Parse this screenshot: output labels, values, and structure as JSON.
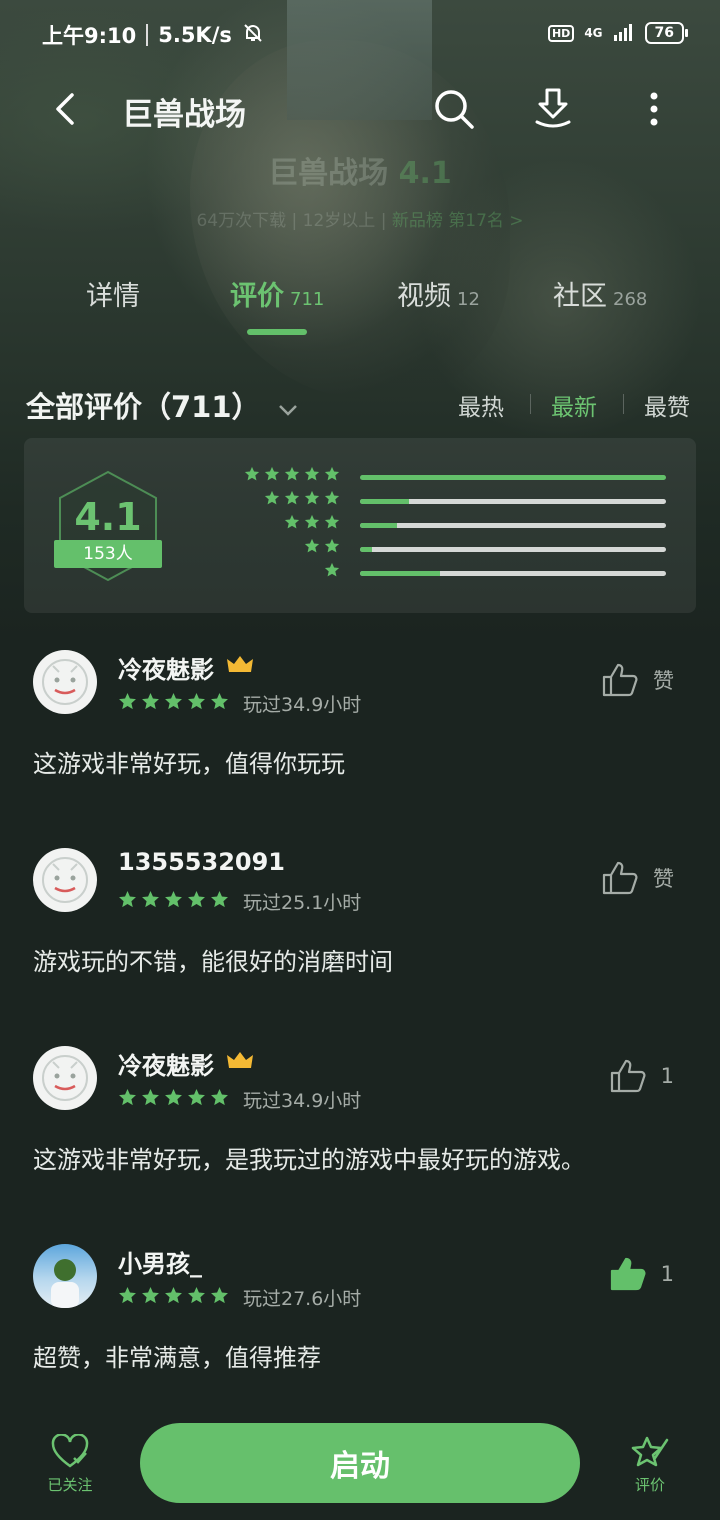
{
  "status_bar": {
    "time": "上午9:10",
    "speed": "5.5K/s",
    "hd": "HD",
    "network": "4G",
    "battery": "76"
  },
  "header": {
    "title": "巨兽战场"
  },
  "game_info": {
    "name": "巨兽战场",
    "rating": "4.1",
    "downloads": "64万次下载",
    "age": "12岁以上",
    "rank": "新品榜 第17名 >"
  },
  "tabs": [
    {
      "label": "详情",
      "count": ""
    },
    {
      "label": "评价",
      "count": "711"
    },
    {
      "label": "视频",
      "count": "12"
    },
    {
      "label": "社区",
      "count": "268"
    }
  ],
  "reviews_header": {
    "title": "全部评价（711）",
    "sort_options": [
      "最热",
      "最新",
      "最赞"
    ],
    "active_sort": "最新"
  },
  "rating_summary": {
    "score": "4.1",
    "people": "153人",
    "distribution": [
      {
        "stars": 5,
        "fraction": 1.0
      },
      {
        "stars": 4,
        "fraction": 0.16
      },
      {
        "stars": 3,
        "fraction": 0.12
      },
      {
        "stars": 2,
        "fraction": 0.04
      },
      {
        "stars": 1,
        "fraction": 0.26
      }
    ]
  },
  "reviews": [
    {
      "name": "冷夜魅影",
      "vip": true,
      "played": "玩过34.9小时",
      "text": "这游戏非常好玩，值得你玩玩",
      "like_label": "赞",
      "liked": false,
      "avatar": "default"
    },
    {
      "name": "1355532091",
      "vip": false,
      "played": "玩过25.1小时",
      "text": "游戏玩的不错，能很好的消磨时间",
      "like_label": "赞",
      "liked": false,
      "avatar": "default"
    },
    {
      "name": "冷夜魅影",
      "vip": true,
      "played": "玩过34.9小时",
      "text": "这游戏非常好玩，是我玩过的游戏中最好玩的游戏。",
      "like_label": "1",
      "liked": false,
      "avatar": "default"
    },
    {
      "name": "小男孩_",
      "vip": false,
      "played": "玩过27.6小时",
      "text": "超赞，非常满意，值得推荐",
      "like_label": "1",
      "liked": true,
      "avatar": "photo"
    }
  ],
  "bottom_bar": {
    "follow_label": "已关注",
    "launch_label": "启动",
    "rate_label": "评价"
  },
  "colors": {
    "accent": "#63c06a",
    "background": "#1b2420"
  }
}
